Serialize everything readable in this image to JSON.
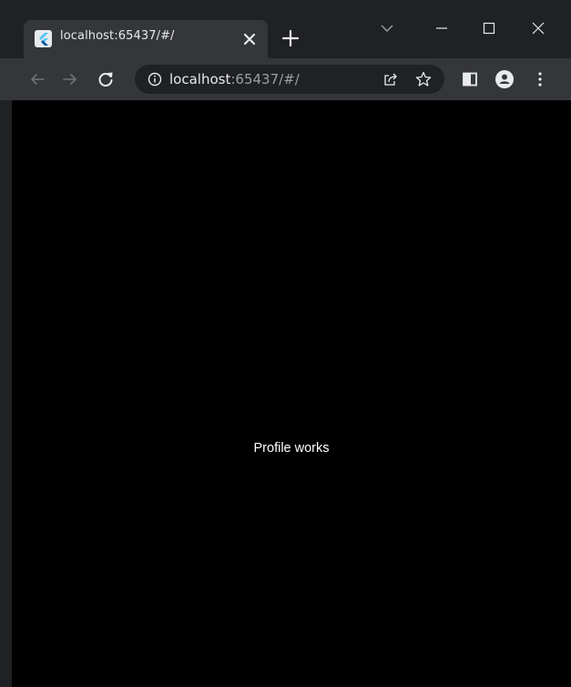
{
  "tab": {
    "title": "localhost:65437/#/",
    "favicon": "flutter-icon"
  },
  "address_bar": {
    "host": "localhost",
    "rest": ":65437/#/"
  },
  "page": {
    "message": "Profile works"
  },
  "colors": {
    "frame": "#202124",
    "toolbar": "#35363a",
    "page_background": "#000000",
    "page_text": "#ffffff",
    "flutter_light": "#54c5f8",
    "flutter_dark": "#01579b"
  }
}
